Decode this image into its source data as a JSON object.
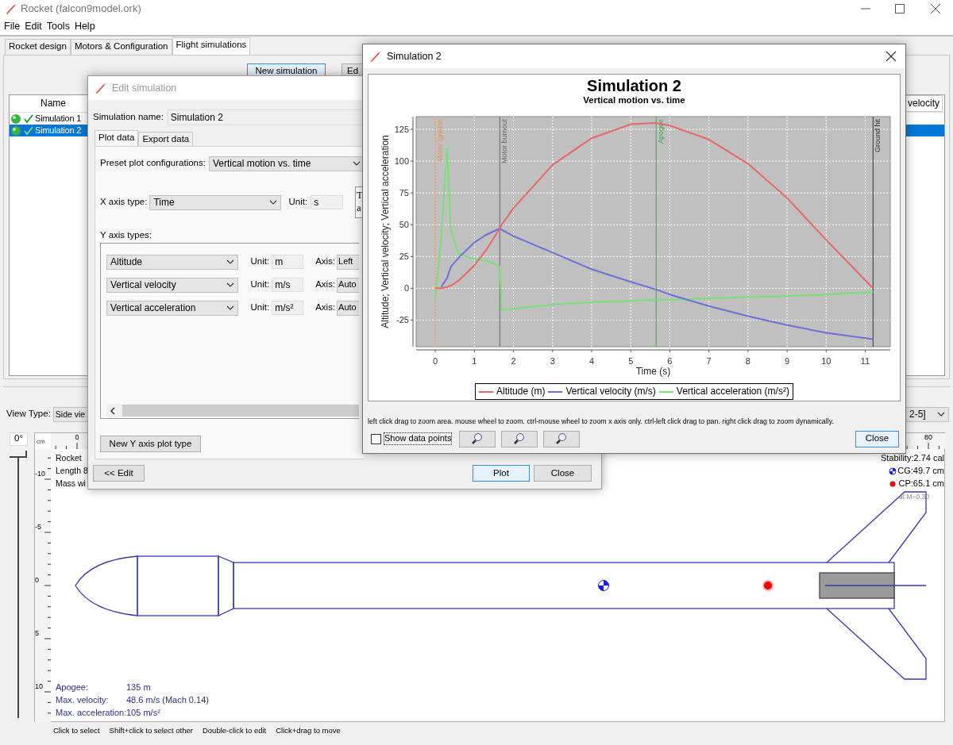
{
  "window": {
    "title": "Rocket (falcon9model.ork)"
  },
  "menu": [
    "File",
    "Edit",
    "Tools",
    "Help"
  ],
  "tabs": [
    {
      "label": "Rocket design",
      "selected": false
    },
    {
      "label": "Motors & Configuration",
      "selected": false
    },
    {
      "label": "Flight simulations",
      "selected": true
    }
  ],
  "simulation_toolbar": [
    "New simulation",
    "Ed"
  ],
  "simulations_table": {
    "columns": [
      "Name",
      "velocity"
    ],
    "rows": [
      {
        "name": "Simulation 1",
        "status_ok": true,
        "selected": false
      },
      {
        "name": "Simulation 2",
        "status_ok": true,
        "selected": true
      }
    ]
  },
  "rocket_view": {
    "view_type_label": "View Type:",
    "view_type": "Side vie",
    "range_fragment": "2-5]",
    "angle": "0°",
    "angle_slider": {
      "level": 1
    },
    "ruler_unit": "cm",
    "h_ruler_labels": [
      "0",
      "80"
    ],
    "v_ruler_labels": [
      "-10",
      "-5",
      "0",
      "5",
      "10"
    ],
    "info": [
      "Rocket",
      "Length 8",
      "Mass wi"
    ],
    "stability": "Stability:2.74 cal",
    "cg": "CG:49.7 cm",
    "cp": "CP:65.1 cm",
    "mach": "at M=0.30",
    "stats": [
      {
        "label": "Apogee:",
        "value": "135 m"
      },
      {
        "label": "Max. velocity:",
        "value": "48.6 m/s  (Mach 0.14)"
      },
      {
        "label": "Max. acceleration:",
        "value": "105 m/s²"
      }
    ],
    "hints": [
      "Click to select",
      "Shift+click to select other",
      "Double-click to edit",
      "Click+drag to move"
    ]
  },
  "edit_dialog": {
    "title": "Edit simulation",
    "name_label": "Simulation name:",
    "name_value": "Simulation 2",
    "tabs": [
      {
        "label": "Plot data",
        "selected": true
      },
      {
        "label": "Export data",
        "selected": false
      }
    ],
    "preset_label": "Preset plot configurations:",
    "preset": "Vertical motion vs. time",
    "x_axis_label": "X axis type:",
    "x_axis": "Time",
    "x_unit_label": "Unit:",
    "x_unit": "s",
    "note_fragment": [
      "T",
      "a"
    ],
    "y_axes_label": "Y axis types:",
    "y_axes": [
      {
        "type": "Altitude",
        "unit_label": "Unit:",
        "unit": "m",
        "axis_label": "Axis:",
        "axis": "Left"
      },
      {
        "type": "Vertical velocity",
        "unit_label": "Unit:",
        "unit": "m/s",
        "axis_label": "Axis:",
        "axis": "Auto"
      },
      {
        "type": "Vertical acceleration",
        "unit_label": "Unit:",
        "unit": "m/s²",
        "axis_label": "Axis:",
        "axis": "Auto"
      }
    ],
    "new_y_button": "New Y axis plot type",
    "back_button": "<< Edit",
    "plot_button": "Plot",
    "close_button": "Close"
  },
  "plot_dialog": {
    "title": "Simulation 2",
    "subtitle": "Vertical motion vs. time",
    "chart_data": {
      "type": "line",
      "title": "Simulation 2",
      "xlabel": "Time (s)",
      "ylabel": "Altitude; Vertical velocity; Vertical acceleration",
      "x": [
        0,
        0.15,
        0.3,
        0.4,
        0.6,
        1,
        1.3,
        1.65,
        1.7,
        2,
        3,
        4,
        5,
        5.65,
        6,
        7,
        8,
        9,
        10,
        11.2
      ],
      "series": [
        {
          "name": "Altitude (m)",
          "color": "#e8676a",
          "values": [
            0,
            0,
            1,
            2,
            6,
            18,
            30,
            47,
            50,
            63,
            97,
            118,
            129,
            130,
            128,
            117,
            98,
            71,
            38,
            0
          ]
        },
        {
          "name": "Vertical velocity (m/s)",
          "color": "#6f6fd8",
          "values": [
            null,
            1,
            8,
            17,
            24,
            36,
            42,
            47,
            46,
            41,
            28,
            15,
            5,
            -1,
            -5,
            -14,
            -22,
            -29,
            -35,
            -40
          ]
        },
        {
          "name": "Vertical acceleration (m/s²)",
          "color": "#78e078",
          "values": [
            -8,
            40,
            110,
            45,
            27,
            23,
            22,
            17,
            -17,
            -16,
            -13,
            -11,
            -10,
            -9,
            -9,
            -8,
            -7,
            -6,
            -5,
            -3
          ]
        }
      ],
      "xlim": [
        -0.49,
        11.64
      ],
      "ylim": [
        -46,
        135
      ],
      "xticks": [
        0,
        1,
        2,
        3,
        4,
        5,
        6,
        7,
        8,
        9,
        10,
        11
      ],
      "yticks": [
        -25,
        0,
        25,
        50,
        75,
        100,
        125
      ],
      "grid": true,
      "ref_lines": [
        {
          "axis": "x",
          "value": 0,
          "label": "Motor ignition",
          "color": "#e0956a"
        },
        {
          "axis": "x",
          "value": 1.65,
          "label": "Motor burnout",
          "color": "#666666"
        },
        {
          "axis": "x",
          "value": 5.65,
          "label": "Apogee",
          "color": "#4f9a4f"
        },
        {
          "axis": "x",
          "value": 11.2,
          "label": "Ground hit",
          "color": "#333333"
        }
      ]
    },
    "hint": "left click drag to zoom area. mouse wheel to zoom. ctrl-mouse wheel to zoom x axis only. ctrl-left click drag to pan.  right click drag to zoom dynamically.",
    "show_points": {
      "label": "Show data points",
      "checked": false
    },
    "close_button": "Close"
  }
}
